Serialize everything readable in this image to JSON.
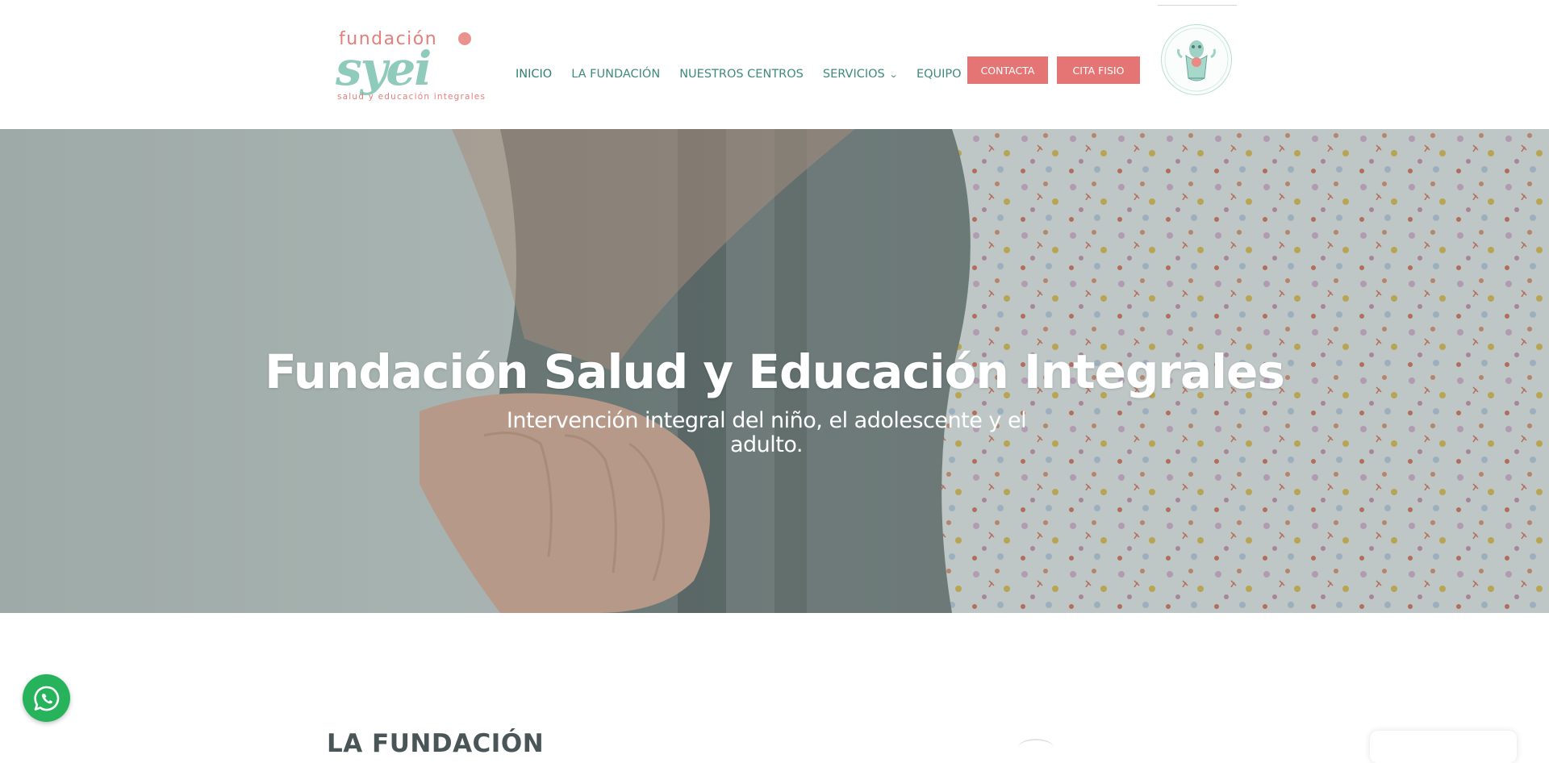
{
  "header": {
    "logo": {
      "top_word": "fundación",
      "big_word": "syei",
      "tagline": "salud y educación integrales"
    },
    "nav": [
      {
        "label": "INICIO"
      },
      {
        "label": "LA FUNDACIÓN"
      },
      {
        "label": "NUESTROS CENTROS"
      },
      {
        "label": "SERVICIOS",
        "has_dropdown": true
      },
      {
        "label": "EQUIPO"
      }
    ],
    "buttons": {
      "contacta": "CONTACTA",
      "cita": "CITA FISIO"
    },
    "badge_icon": "mascot-badge-icon"
  },
  "hero": {
    "title": "Fundación Salud y Educación Integrales",
    "subtitle": "Intervención integral del niño, el adolescente y el adulto."
  },
  "section": {
    "title": "LA FUNDACIÓN"
  },
  "floating": {
    "whatsapp_icon": "whatsapp-icon"
  },
  "colors": {
    "accent_coral": "#e57574",
    "nav_teal": "#3f8a7c",
    "logo_mint": "#8fcbbb",
    "whatsapp_green": "#26b35b",
    "heading_gray": "#4a5558"
  }
}
